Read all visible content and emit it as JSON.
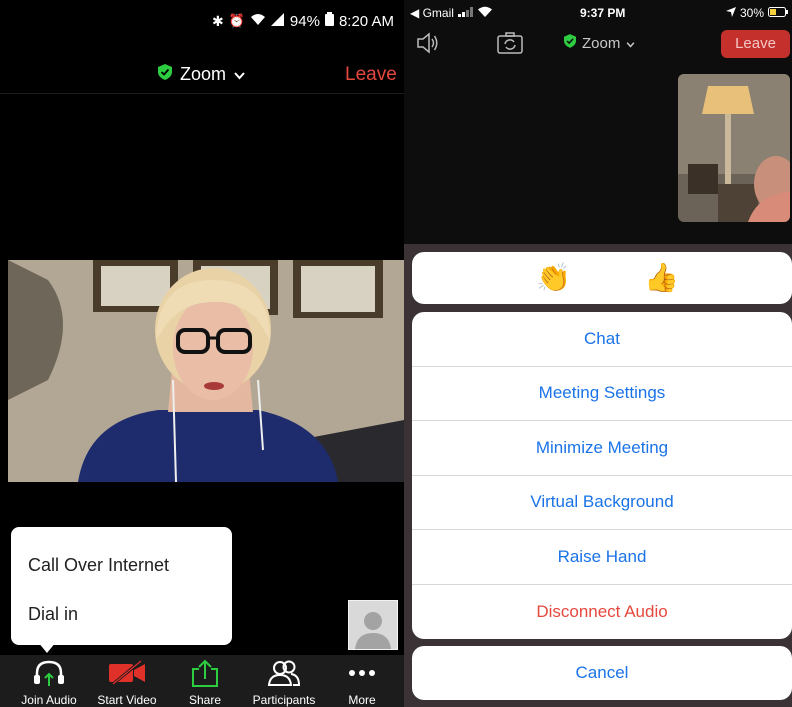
{
  "left": {
    "status": {
      "battery": "94%",
      "time": "8:20 AM"
    },
    "header": {
      "title": "Zoom",
      "leave": "Leave"
    },
    "audio_popup": {
      "items": [
        "Call Over Internet",
        "Dial in"
      ]
    },
    "toolbar": {
      "join_audio": "Join Audio",
      "start_video": "Start Video",
      "share": "Share",
      "participants": "Participants",
      "more": "More"
    }
  },
  "right": {
    "status": {
      "carrier": "◀ Gmail",
      "time": "9:37 PM",
      "battery": "30%"
    },
    "toolbar": {
      "title": "Zoom",
      "leave": "Leave"
    },
    "reactions": [
      "👏",
      "👍"
    ],
    "menu": [
      "Chat",
      "Meeting Settings",
      "Minimize Meeting",
      "Virtual Background",
      "Raise Hand"
    ],
    "disconnect": "Disconnect Audio",
    "cancel": "Cancel"
  },
  "colors": {
    "leave_red": "#e5483e",
    "ios_blue": "#1a73e8",
    "share_green": "#2ecc40",
    "video_red": "#e0302a"
  }
}
